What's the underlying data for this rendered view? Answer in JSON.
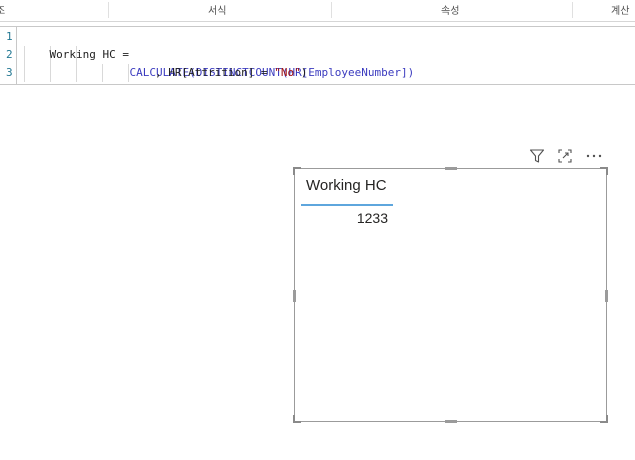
{
  "ribbon": {
    "group_labels": [
      "조",
      "서식",
      "속성",
      "계산"
    ]
  },
  "formula": {
    "line_numbers": [
      "1",
      "2",
      "3"
    ],
    "line1": "Working HC =",
    "line2": "CALCULATE(DISTINCTCOUNT(HR[EmployeeNumber])",
    "line3_prefix": ", HR[Attrition] = ",
    "line3_string": "\"No\"",
    "line3_suffix": ")"
  },
  "visual_header": {
    "icons": [
      "filter-icon",
      "focus-mode-icon",
      "more-options-icon"
    ]
  },
  "card": {
    "title": "Working HC",
    "value": "1233"
  },
  "colors": {
    "accent_underline": "#5ea6dd",
    "function_token": "#3b3bbf",
    "string_token": "#a31515",
    "line_number": "#237893"
  }
}
